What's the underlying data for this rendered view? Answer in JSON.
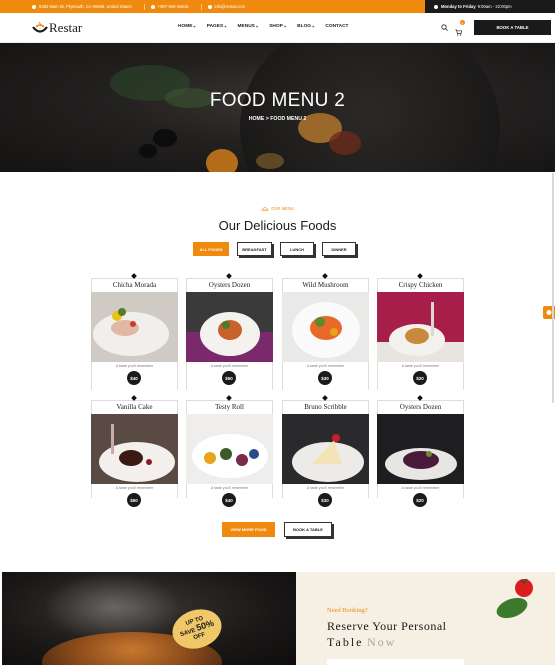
{
  "topbar": {
    "address": "9482 Main St, Plymouth, CA 95669, United States",
    "phone": "+987-629-18615",
    "email": "info@restar.com",
    "hours_label": "Monday to Friday",
    "hours_value": "9:00am - 22:00pm"
  },
  "header": {
    "logo": "Restar",
    "nav": [
      {
        "label": "HOME",
        "caret": "+"
      },
      {
        "label": "PAGES",
        "caret": "+"
      },
      {
        "label": "MENUS",
        "caret": "+"
      },
      {
        "label": "SHOP",
        "caret": "+"
      },
      {
        "label": "BLOG",
        "caret": "+"
      },
      {
        "label": "CONTACT",
        "caret": ""
      }
    ],
    "cart_count": "0",
    "book_button": "BOOK A TABLE"
  },
  "hero": {
    "title": "FOOD MENU 2",
    "crumb_home": "HOME",
    "crumb_sep": ">",
    "crumb_current": "FOOD MENU 2"
  },
  "section": {
    "tag": "OUR MENU",
    "title": "Our Delicious Foods",
    "tabs": [
      "ALL FOODS",
      "BREAKFAST",
      "LUNCH",
      "DINNER"
    ]
  },
  "menu": [
    {
      "name": "Chicha Morada",
      "desc": "A taste you'll remember",
      "price": "$40"
    },
    {
      "name": "Oysters Dozen",
      "desc": "A taste you'll remember",
      "price": "$50"
    },
    {
      "name": "Wild Mushroom",
      "desc": "A taste you'll remember",
      "price": "$30"
    },
    {
      "name": "Crispy Chicken",
      "desc": "A taste you'll remember",
      "price": "$20"
    },
    {
      "name": "Vanilla Cake",
      "desc": "A taste you'll remember",
      "price": "$50"
    },
    {
      "name": "Testy Roll",
      "desc": "A taste you'll remember",
      "price": "$40"
    },
    {
      "name": "Bruno Scribble",
      "desc": "A taste you'll remember",
      "price": "$30"
    },
    {
      "name": "Oysters Dozen",
      "desc": "A taste you'll remember",
      "price": "$20"
    }
  ],
  "buttons": {
    "view_more": "VIEW MORE FOOD",
    "book": "BOOK A TABLE"
  },
  "promo": {
    "badge_line1": "UP TO",
    "badge_line2": "SAVE",
    "badge_big": "50%",
    "badge_line3": "OFF"
  },
  "reserve": {
    "need": "Need Booking?",
    "line1": "Reserve Your Personal",
    "line2a": "Table",
    "line2b": "Now"
  },
  "colors": {
    "accent": "#f08a0e",
    "dark": "#1a1a1a"
  }
}
